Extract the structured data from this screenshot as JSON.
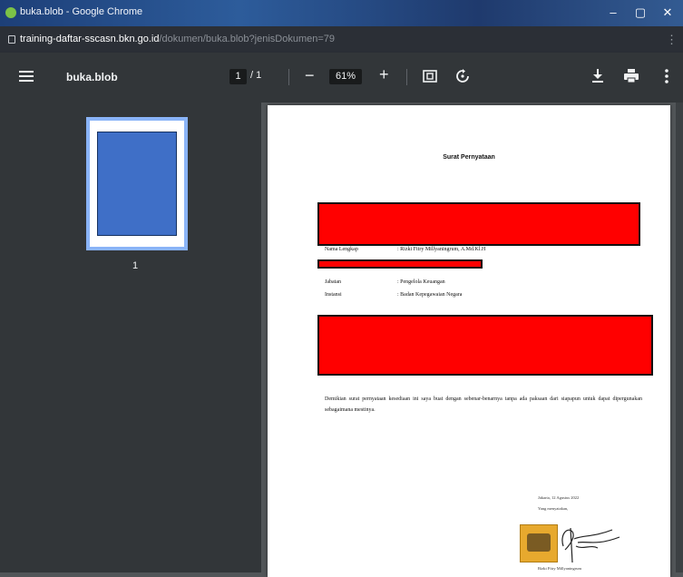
{
  "window": {
    "title": "buka.blob - Google Chrome",
    "buttons": [
      "–",
      "▢",
      "✕"
    ]
  },
  "address_bar": {
    "host": "training-daftar-sscasn.bkn.go.id",
    "path": "/dokumen/buka.blob?jenisDokumen=79"
  },
  "toolbar": {
    "menu_icon": "hamburger-menu-icon",
    "document_name": "buka.blob",
    "current_page": "1",
    "total_pages": "/ 1",
    "zoom_out": "−",
    "zoom_level": "61%",
    "zoom_in": "+",
    "fit_icon": "fit-to-page-icon",
    "rotate_icon": "rotate-icon",
    "download_icon": "download-icon",
    "print_icon": "print-icon",
    "more_icon": "more-vertical-icon"
  },
  "sidebar": {
    "thumbnails": [
      {
        "page_number": "1"
      }
    ]
  },
  "document": {
    "heading": "Surat Pernyataan",
    "fields": [
      {
        "label": "Nama Lengkap",
        "value": ": Rizki Fitry Millyaningrum, A.Md.Kl.H"
      },
      {
        "label": "Jabatan",
        "value": ": Pengelola Keuangan"
      },
      {
        "label": "Instansi",
        "value": ": Badan Kepegawaian Negara"
      }
    ],
    "body_text": "Demikian surat pernyataan kesediaan ini saya buat dengan sebenar-benarnya tanpa ada paksaan dari siapapun untuk dapat dipergunakan sebagaimana mestinya.",
    "signature": {
      "place_date": "Jakarta, 12 Agustus 2022",
      "role": "Yang menyatakan,",
      "name": "Rizki Fitry Millyaningrum"
    },
    "redaction_color": "#ff0000"
  },
  "colors": {
    "toolbar_bg": "#323639",
    "viewer_bg": "#525659",
    "thumbnail_border": "#8ab4f8"
  }
}
